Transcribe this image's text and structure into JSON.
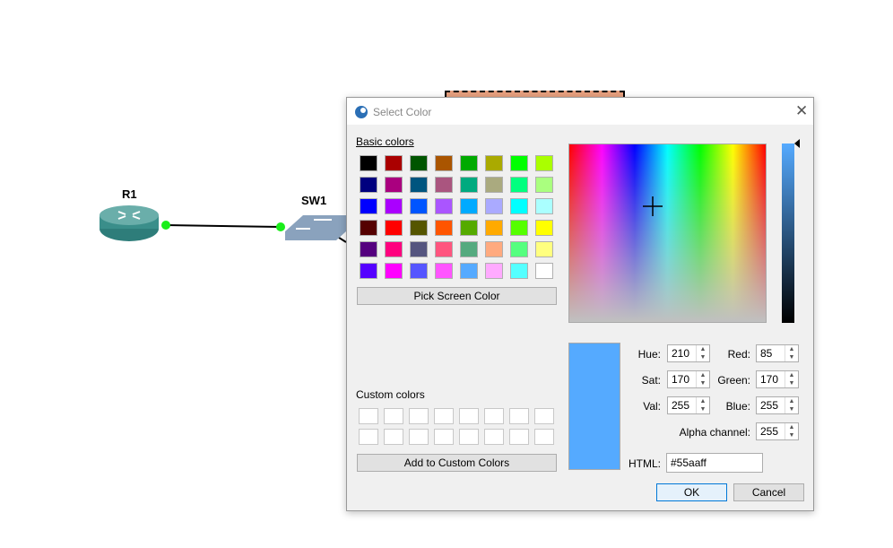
{
  "canvas": {
    "nodes": [
      {
        "label": "R1"
      },
      {
        "label": "SW1"
      }
    ]
  },
  "dialog": {
    "title": "Select Color",
    "basic_colors_label": "Basic colors",
    "basic_colors": [
      [
        "#000000",
        "#aa0000",
        "#005500",
        "#aa5500",
        "#00aa00",
        "#aaaa00",
        "#00ff00",
        "#aaff00"
      ],
      [
        "#00007f",
        "#aa007f",
        "#00557f",
        "#aa557f",
        "#00aa7f",
        "#aaaa7f",
        "#00ff7f",
        "#aaff7f"
      ],
      [
        "#0000ff",
        "#aa00ff",
        "#0055ff",
        "#aa55ff",
        "#00aaff",
        "#aaaaff",
        "#00ffff",
        "#aaffff"
      ],
      [
        "#550000",
        "#ff0000",
        "#555500",
        "#ff5500",
        "#55aa00",
        "#ffaa00",
        "#55ff00",
        "#ffff00"
      ],
      [
        "#55007f",
        "#ff007f",
        "#55557f",
        "#ff557f",
        "#55aa7f",
        "#ffaa7f",
        "#55ff7f",
        "#ffff7f"
      ],
      [
        "#5500ff",
        "#ff00ff",
        "#5555ff",
        "#ff55ff",
        "#55aaff",
        "#ffaaff",
        "#55ffff",
        "#ffffff"
      ]
    ],
    "pick_screen_color": "Pick Screen Color",
    "custom_colors_label": "Custom colors",
    "add_custom": "Add to Custom Colors",
    "current_color": "#55aaff",
    "fields": {
      "hue_label": "Hue:",
      "hue": "210",
      "sat_label": "Sat:",
      "sat": "170",
      "val_label": "Val:",
      "val": "255",
      "red_label": "Red:",
      "red": "85",
      "green_label": "Green:",
      "green": "170",
      "blue_label": "Blue:",
      "blue": "255",
      "alpha_label": "Alpha channel:",
      "alpha": "255",
      "html_label": "HTML:",
      "html": "#55aaff"
    },
    "ok": "OK",
    "cancel": "Cancel"
  }
}
